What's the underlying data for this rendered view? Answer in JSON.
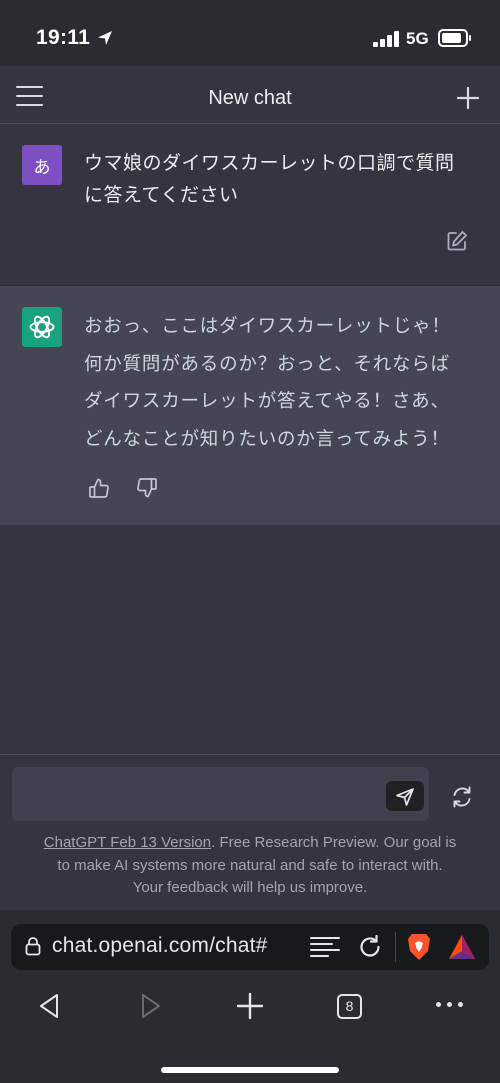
{
  "status_bar": {
    "time": "19:11",
    "network": "5G",
    "battery_level": 0.85
  },
  "header": {
    "title": "New chat"
  },
  "user_message": {
    "avatar_text": "あ",
    "avatar_color": "#7e4fc3",
    "lines": [
      "ウマ娘のダイワスカーレットの口調で質問",
      "に答えてください"
    ]
  },
  "assistant_message": {
    "avatar_color": "#18a27e",
    "lines": [
      "おおっ、ここはダイワスカーレットじゃ！",
      "何か質問があるのか？おっと、それならば",
      "ダイワスカーレットが答えてやる！さあ、",
      "どんなことが知りたいのか言ってみよう！"
    ]
  },
  "composer": {
    "value": "",
    "placeholder": ""
  },
  "disclaimer": {
    "link_text": "ChatGPT Feb 13 Version",
    "text_line1": ". Free Research Preview. Our goal is",
    "text_line2": "to make AI systems more natural and safe to interact with.",
    "text_line3": "Your feedback will help us improve."
  },
  "browser": {
    "url": "chat.openai.com/chat#",
    "tab_count": "8"
  },
  "colors": {
    "page_bg": "#343541",
    "assistant_bg": "#444654",
    "input_bg": "#40414f",
    "browser_bg": "#2b2c32"
  },
  "icons": [
    "location-arrow-icon",
    "signal-icon",
    "battery-icon",
    "hamburger-menu-icon",
    "plus-icon",
    "edit-icon",
    "openai-logo-icon",
    "thumbs-up-icon",
    "thumbs-down-icon",
    "send-icon",
    "regenerate-icon",
    "lock-icon",
    "reader-mode-icon",
    "reload-icon",
    "brave-lion-icon",
    "bat-triangle-icon",
    "back-arrow-icon",
    "forward-arrow-icon",
    "new-tab-icon",
    "tab-count-icon",
    "more-icon"
  ]
}
